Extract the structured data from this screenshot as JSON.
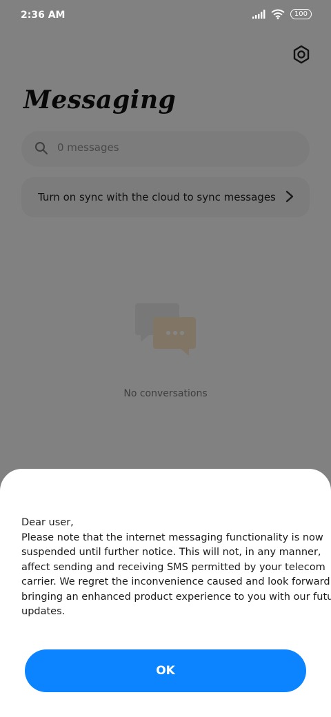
{
  "status_bar": {
    "time": "2:36 AM",
    "battery": "100"
  },
  "header": {
    "title": "Messaging",
    "settings_icon": "gear-icon"
  },
  "search": {
    "placeholder": "0 messages",
    "icon": "search-icon"
  },
  "sync_banner": {
    "label": "Turn on sync with the cloud to sync messages",
    "icon": "chevron-right-icon"
  },
  "empty_state": {
    "text": "No conversations",
    "icon": "chat-bubbles-icon"
  },
  "dialog": {
    "lines": [
      "Dear user,",
      "Please note that the internet messaging functionality is now",
      "suspended until further notice. This will not, in any manner,",
      "affect sending and receiving SMS permitted by your telecom",
      "carrier. We regret the inconvenience caused and look forward to",
      "bringing an enhanced product experience to you with our future",
      "updates."
    ],
    "ok_label": "OK"
  },
  "colors": {
    "accent": "#0d84ff",
    "overlay": "rgba(0,0,0,0.48)"
  }
}
